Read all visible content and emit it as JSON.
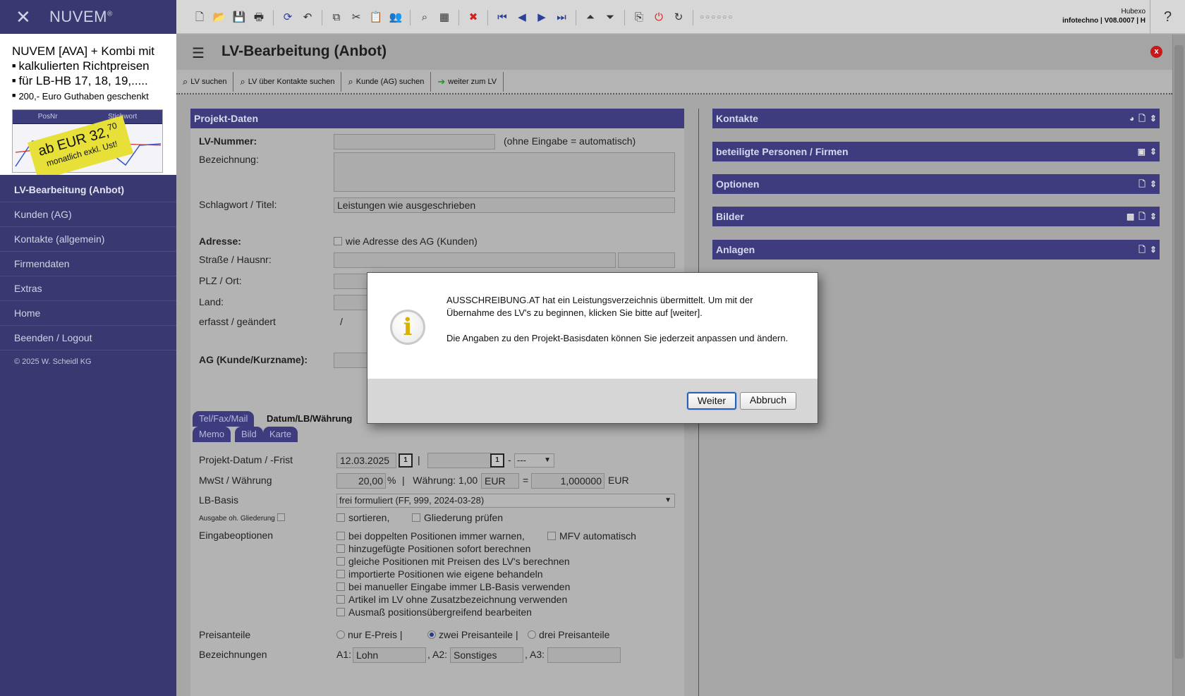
{
  "app": {
    "brand": "NUVEM",
    "reg": "®"
  },
  "ad": {
    "line1": "NUVEM [AVA] + Kombi mit",
    "line2": "kalkulierten Richtpreisen",
    "line3": "für LB-HB 17, 18, 19,.....",
    "line4": "200,- Euro Guthaben geschenkt",
    "thumb_col1": "PosNr",
    "thumb_col2": "Stichwort",
    "price_main": "ab EUR 32,",
    "price_cents": "70",
    "price_sub": "monatlich exkl. Ust!"
  },
  "nav": {
    "items": [
      {
        "label": "LV-Bearbeitung (Anbot)"
      },
      {
        "label": "Kunden (AG)"
      },
      {
        "label": "Kontakte (allgemein)"
      },
      {
        "label": "Firmendaten"
      },
      {
        "label": "Extras"
      },
      {
        "label": "Home"
      },
      {
        "label": "Beenden / Logout"
      }
    ],
    "copyright": "© 2025 W. Scheidl KG"
  },
  "topbar": {
    "user": "Hubexo",
    "info": "infotechno | V08.0007 | H",
    "help": "?"
  },
  "page": {
    "title": "LV-Bearbeitung (Anbot)",
    "close": "x"
  },
  "subtoolbar": {
    "btn1": "LV suchen",
    "btn2": "LV über Kontakte suchen",
    "btn3": "Kunde (AG) suchen",
    "btn4": "weiter zum LV"
  },
  "projekt": {
    "header": "Projekt-Daten",
    "lv_nummer_label": "LV-Nummer:",
    "lv_nummer_hint": "(ohne Eingabe = automatisch)",
    "bezeichnung_label": "Bezeichnung:",
    "schlagwort_label": "Schlagwort / Titel:",
    "schlagwort_value": "Leistungen wie ausgeschrieben",
    "adresse_label": "Adresse:",
    "adresse_cb": "wie Adresse des AG (Kunden)",
    "strasse_label": "Straße / Hausnr:",
    "plz_label": "PLZ / Ort:",
    "land_label": "Land:",
    "erfasst_label": "erfasst / geändert",
    "erfasst_value": "/",
    "ag_label": "AG (Kunde/Kurzname):"
  },
  "tabs": {
    "tel": "Tel/Fax/Mail",
    "datum": "Datum/LB/Währung",
    "memo": "Memo",
    "bild": "Bild",
    "karte": "Karte"
  },
  "details": {
    "datum_label": "Projekt-Datum / -Frist",
    "datum_value": "12.03.2025",
    "cal": "1",
    "sep": "|",
    "dash": "-",
    "frist_select": "---",
    "mwst_label": "MwSt / Währung",
    "mwst_value": "20,00",
    "pct": "%",
    "waehrung_text": "|   Währung: 1,00",
    "waehrung_value": "EUR",
    "eq": "=",
    "rate_value": "1,000000",
    "rate_unit": "EUR",
    "lb_label": "LB-Basis",
    "lb_value": "frei formuliert (FF, 999, 2024-03-28)",
    "ausgabe_label": "Ausgabe oh. Gliederung",
    "sortieren": "sortieren,",
    "gliederung": "Gliederung prüfen",
    "eingabe_label": "Eingabeoptionen",
    "opt1": "bei doppelten Positionen immer warnen,",
    "opt1b": "MFV automatisch",
    "opt2": "hinzugefügte Positionen sofort berechnen",
    "opt3": "gleiche Positionen mit Preisen des LV's berechnen",
    "opt4": "importierte Positionen wie eigene behandeln",
    "opt5": "bei manueller Eingabe immer LB-Basis verwenden",
    "opt6": "Artikel im LV ohne Zusatzbezeichnung verwenden",
    "opt7": "Ausmaß positionsübergreifend bearbeiten",
    "preis_label": "Preisanteile",
    "preis1": "nur E-Preis",
    "preis2": "zwei Preisanteile",
    "preis3": "drei Preisanteile",
    "bez_label": "Bezeichnungen",
    "a1": "A1:",
    "a1_value": "Lohn",
    "a2": ", A2:",
    "a2_value": "Sonstiges",
    "a3": ", A3:",
    "a3_value": ""
  },
  "right": {
    "kontakte": "Kontakte",
    "beteiligte": "beteiligte Personen / Firmen",
    "optionen": "Optionen",
    "bilder": "Bilder",
    "anlagen": "Anlagen"
  },
  "dialog": {
    "icon": "i",
    "p1": "AUSSCHREIBUNG.AT hat ein Leistungsverzeichnis übermittelt. Um mit der Übernahme des LV's zu beginnen, klicken Sie bitte auf [weiter].",
    "p2": "Die Angaben zu den Projekt-Basisdaten können Sie jederzeit anpassen und ändern.",
    "ok": "Weiter",
    "cancel": "Abbruch"
  }
}
